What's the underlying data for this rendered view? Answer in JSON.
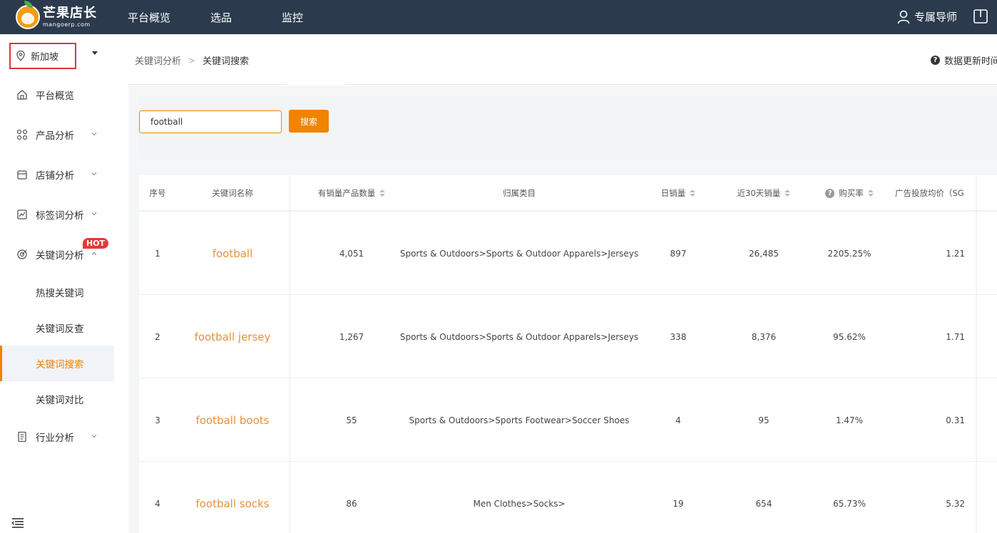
{
  "brand": {
    "name_cn": "芒果店长",
    "name_en": "mangoerp.com",
    "color": "#f08300"
  },
  "topnav": {
    "items": [
      "平台概览",
      "选品",
      "监控"
    ],
    "guide": "专属导师"
  },
  "sidebar": {
    "region": "新加坡",
    "items": [
      {
        "label": "平台概览",
        "icon": "home-icon"
      },
      {
        "label": "产品分析",
        "icon": "grid-icon"
      },
      {
        "label": "店铺分析",
        "icon": "store-icon"
      },
      {
        "label": "标签词分析",
        "icon": "chart-icon"
      },
      {
        "label": "关键词分析",
        "icon": "target-icon",
        "badge": "HOT"
      },
      {
        "label": "行业分析",
        "icon": "report-icon"
      }
    ],
    "sub_items": [
      "热搜关键词",
      "关键词反查",
      "关键词搜索",
      "关键词对比"
    ]
  },
  "breadcrumb": {
    "parent": "关键词分析",
    "current": "关键词搜索"
  },
  "update_info": "数据更新时间",
  "search": {
    "value": "football",
    "button": "搜索"
  },
  "table": {
    "headers": {
      "index": "序号",
      "keyword": "关键词名称",
      "product_count": "有销量产品数量",
      "category": "归属类目",
      "daily_sales": "日销量",
      "sales_30d": "近30天销量",
      "buy_rate": "购买率",
      "ad_price": "广告投放均价（SG"
    },
    "rows": [
      {
        "index": "1",
        "keyword": "football",
        "product_count": "4,051",
        "category": "Sports & Outdoors>Sports & Outdoor Apparels>Jerseys",
        "daily_sales": "897",
        "sales_30d": "26,485",
        "buy_rate": "2205.25%",
        "ad_price": "1.21"
      },
      {
        "index": "2",
        "keyword": "football jersey",
        "product_count": "1,267",
        "category": "Sports & Outdoors>Sports & Outdoor Apparels>Jerseys",
        "daily_sales": "338",
        "sales_30d": "8,376",
        "buy_rate": "95.62%",
        "ad_price": "1.71"
      },
      {
        "index": "3",
        "keyword": "football boots",
        "product_count": "55",
        "category": "Sports & Outdoors>Sports Footwear>Soccer Shoes",
        "daily_sales": "4",
        "sales_30d": "95",
        "buy_rate": "1.47%",
        "ad_price": "0.31"
      },
      {
        "index": "4",
        "keyword": "football socks",
        "product_count": "86",
        "category": "Men Clothes>Socks>",
        "daily_sales": "19",
        "sales_30d": "654",
        "buy_rate": "65.73%",
        "ad_price": "5.32"
      }
    ]
  }
}
